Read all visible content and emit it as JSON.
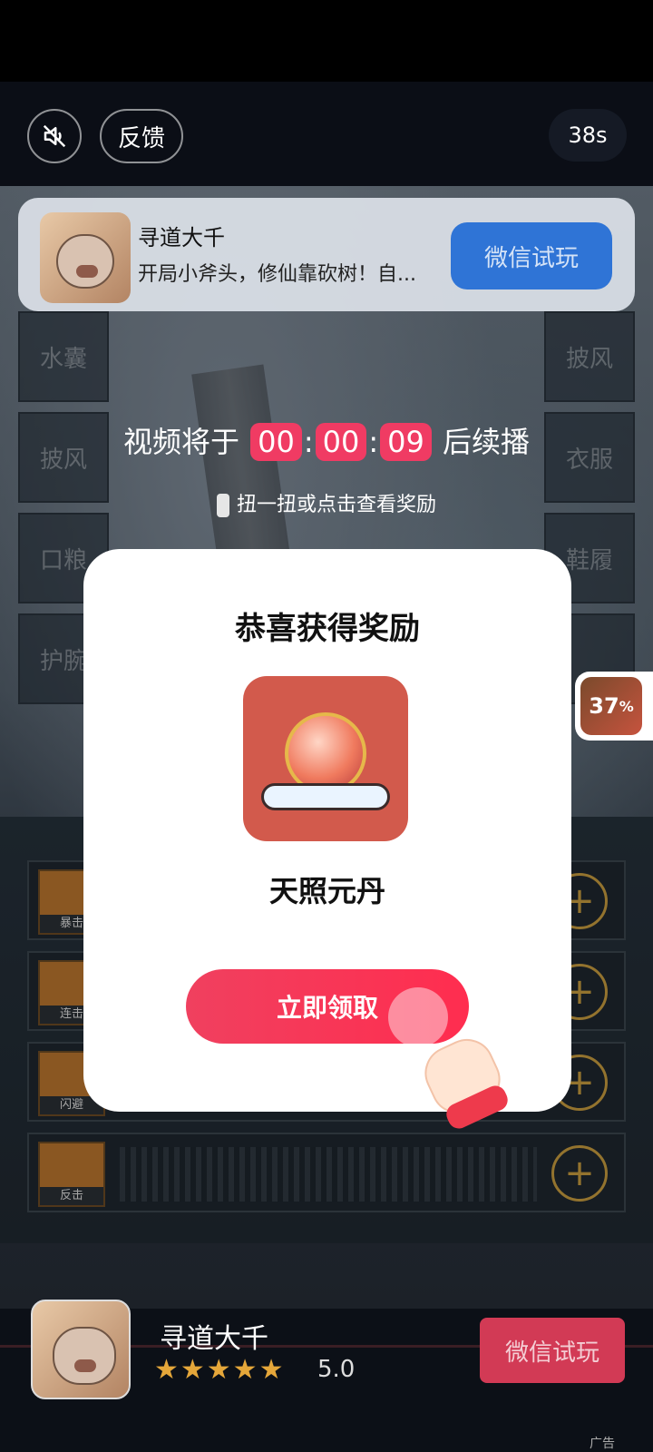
{
  "top": {
    "mute_icon": "speaker-muted-icon",
    "feedback_label": "反馈",
    "timer": "38s"
  },
  "game": {
    "left_slots": [
      "水囊",
      "披风",
      "口粮",
      "护腕"
    ],
    "right_slots": [
      "披风",
      "衣服",
      "鞋履",
      ""
    ],
    "skills": [
      "暴击",
      "连击",
      "闪避",
      "反击"
    ]
  },
  "ad_card": {
    "title": "寻道大千",
    "desc": "开局小斧头，修仙靠砍树！自...",
    "cta": "微信试玩"
  },
  "countdown": {
    "prefix": "视频将于",
    "hh": "00",
    "mm": "00",
    "ss": "09",
    "suffix": "后续播",
    "hint": "扭一扭或点击查看奖励"
  },
  "progress_badge": {
    "value": "37",
    "unit": "%"
  },
  "modal": {
    "heading": "恭喜获得奖励",
    "reward_name": "天照元丹",
    "claim_label": "立即领取"
  },
  "bottom": {
    "title": "寻道大千",
    "stars": "★★★★★",
    "rating": "5.0",
    "cta": "微信试玩",
    "ad_label": "广告"
  },
  "colors": {
    "accent_red": "#f03b63",
    "cta_blue": "#2f74d6",
    "star": "#e5a73a"
  }
}
